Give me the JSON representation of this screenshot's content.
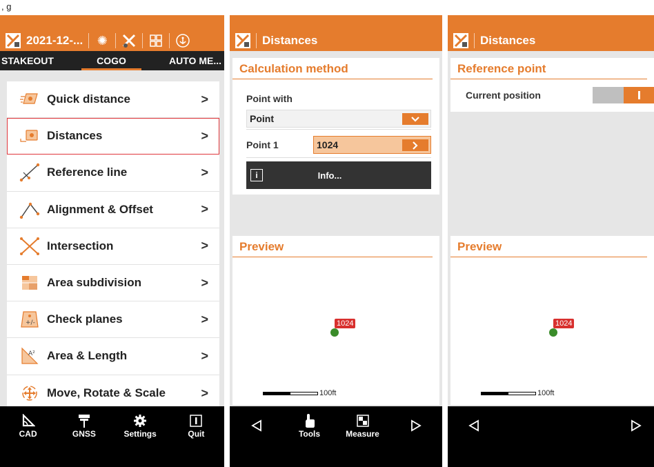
{
  "top_strip_text": ", g",
  "panel1": {
    "title": "2021-12-...",
    "tabs": [
      "STAKEOUT",
      "COGO",
      "AUTO ME..."
    ],
    "active_tab": 1,
    "menu": [
      {
        "label": "Quick distance",
        "icon": "quick-distance-icon"
      },
      {
        "label": "Distances",
        "icon": "distances-icon"
      },
      {
        "label": "Reference line",
        "icon": "reference-line-icon"
      },
      {
        "label": "Alignment & Offset",
        "icon": "alignment-offset-icon"
      },
      {
        "label": "Intersection",
        "icon": "intersection-icon"
      },
      {
        "label": "Area subdivision",
        "icon": "area-subdivision-icon"
      },
      {
        "label": "Check planes",
        "icon": "check-planes-icon"
      },
      {
        "label": "Area & Length",
        "icon": "area-length-icon"
      },
      {
        "label": "Move, Rotate & Scale",
        "icon": "move-rotate-scale-icon"
      }
    ],
    "chevron": ">",
    "bottom": [
      {
        "label": "CAD",
        "icon": "cad-icon"
      },
      {
        "label": "GNSS",
        "icon": "gnss-icon"
      },
      {
        "label": "Settings",
        "icon": "gear-icon"
      },
      {
        "label": "Quit",
        "icon": "quit-icon"
      }
    ]
  },
  "panel2": {
    "title": "Distances",
    "calc_title": "Calculation method",
    "point_with_label": "Point with",
    "point_with_value": "Point",
    "point1_label": "Point 1",
    "point1_value": "1024",
    "info_label": "Info...",
    "info_icon_char": "i",
    "preview_title": "Preview",
    "marker_label": "1024",
    "scale_label": "100ft",
    "bottom": [
      {
        "label": "",
        "icon": "prev-icon"
      },
      {
        "label": "Tools",
        "icon": "tools-hand-icon"
      },
      {
        "label": "Measure",
        "icon": "measure-icon"
      },
      {
        "label": "",
        "icon": "next-icon"
      }
    ]
  },
  "panel3": {
    "title": "Distances",
    "ref_title": "Reference point",
    "current_position_label": "Current position",
    "preview_title": "Preview",
    "marker_label": "1024",
    "scale_label": "100ft"
  },
  "colors": {
    "accent": "#e57c2d",
    "highlight": "#e0353a",
    "marker_green": "#3a8c2a",
    "marker_red": "#d8302e"
  }
}
